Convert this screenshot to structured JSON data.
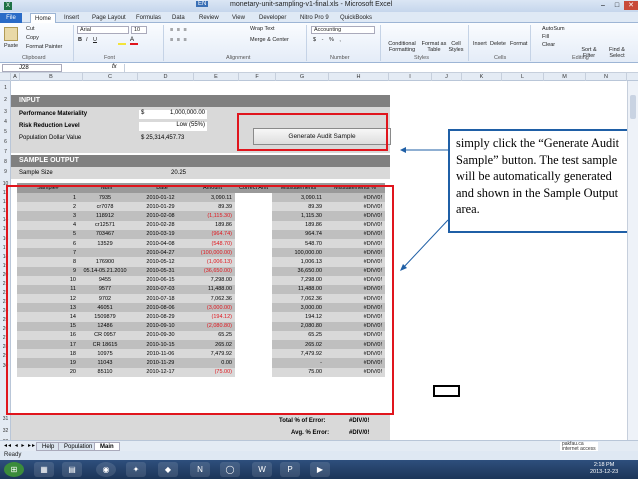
{
  "window": {
    "title": "monetary-unit-sampling-v1-final.xls - Microsoft Excel",
    "lang": "EN"
  },
  "ribbon_tabs": [
    "File",
    "Home",
    "Insert",
    "Page Layout",
    "Formulas",
    "Data",
    "Review",
    "View",
    "Developer",
    "Nitro Pro 9",
    "QuickBooks"
  ],
  "ribbon": {
    "clipboard": {
      "paste": "Paste",
      "cut": "Cut",
      "copy": "Copy",
      "format_painter": "Format Painter",
      "group": "Clipboard"
    },
    "font": {
      "name": "Arial",
      "size": "10",
      "group": "Font"
    },
    "alignment": {
      "wrap": "Wrap Text",
      "merge": "Merge & Center",
      "group": "Alignment"
    },
    "number": {
      "format": "Accounting",
      "symbols": "$ - % ,",
      "group": "Number"
    },
    "styles": {
      "cond": "Conditional Formatting",
      "fmt_table": "Format as Table",
      "cell_styles": "Cell Styles",
      "group": "Styles"
    },
    "cells": {
      "insert": "Insert",
      "delete": "Delete",
      "format": "Format",
      "group": "Cells"
    },
    "editing": {
      "autosum": "AutoSum",
      "fill": "Fill",
      "clear": "Clear",
      "sort": "Sort & Filter",
      "find": "Find & Select",
      "group": "Editing"
    }
  },
  "formula_bar": {
    "name_box": "J28",
    "fx": "fx",
    "value": ""
  },
  "columns": [
    "A",
    "B",
    "C",
    "D",
    "E",
    "F",
    "G",
    "H",
    "I",
    "J",
    "K",
    "L",
    "M",
    "N"
  ],
  "rows": [
    "1",
    "2",
    "3",
    "4",
    "5",
    "6",
    "7",
    "8",
    "9",
    "10",
    "11",
    "12",
    "13",
    "14",
    "15",
    "16",
    "17",
    "18",
    "19",
    "20",
    "21",
    "22",
    "23",
    "24",
    "25",
    "26",
    "27",
    "28",
    "29",
    "30",
    "31",
    "32",
    "33"
  ],
  "input": {
    "header": "INPUT",
    "materiality_label": "Performance Materiality",
    "materiality_sym": "$",
    "materiality_value": "1,000,000.00",
    "risk_label": "Risk Reduction Level",
    "risk_value": "Low (55%)",
    "population_label": "Population Dollar Value",
    "population_value": "$ 25,314,457.73",
    "button": "Generate Audit Sample"
  },
  "output": {
    "header": "SAMPLE OUTPUT",
    "size_label": "Sample Size",
    "size_value": "20.25",
    "columns": [
      "Sample#",
      "Num",
      "Date",
      "Amount",
      "Correct Amt",
      "Misstatements",
      "Misstatements %"
    ],
    "rows": [
      [
        "1",
        "7935",
        "2010-01-12",
        "3,090.11",
        "",
        "3,090.11",
        "#DIV/0!"
      ],
      [
        "2",
        "cr7078",
        "2010-01-29",
        "89.39",
        "",
        "89.39",
        "#DIV/0!"
      ],
      [
        "3",
        "118912",
        "2010-02-08",
        "(1,115.30)",
        "",
        "1,115.30",
        "#DIV/0!"
      ],
      [
        "4",
        "cr12571",
        "2010-02-28",
        "189.86",
        "",
        "189.86",
        "#DIV/0!"
      ],
      [
        "5",
        "703467",
        "2010-03-19",
        "(964.74)",
        "",
        "964.74",
        "#DIV/0!"
      ],
      [
        "6",
        "13529",
        "2010-04-08",
        "(548.70)",
        "",
        "548.70",
        "#DIV/0!"
      ],
      [
        "7",
        "",
        "2010-04-27",
        "(100,000.00)",
        "",
        "100,000.00",
        "#DIV/0!"
      ],
      [
        "8",
        "176900",
        "2010-05-12",
        "(1,006.13)",
        "",
        "1,006.13",
        "#DIV/0!"
      ],
      [
        "9",
        "05.14-05.21.2010",
        "2010-05-31",
        "(36,650.00)",
        "",
        "36,650.00",
        "#DIV/0!"
      ],
      [
        "10",
        "9455",
        "2010-06-15",
        "7,298.00",
        "",
        "7,298.00",
        "#DIV/0!"
      ],
      [
        "11",
        "9577",
        "2010-07-03",
        "11,488.00",
        "",
        "11,488.00",
        "#DIV/0!"
      ],
      [
        "12",
        "9702",
        "2010-07-18",
        "7,062.36",
        "",
        "7,062.36",
        "#DIV/0!"
      ],
      [
        "13",
        "46051",
        "2010-08-06",
        "(3,000.00)",
        "",
        "3,000.00",
        "#DIV/0!"
      ],
      [
        "14",
        "1509879",
        "2010-08-29",
        "(194.12)",
        "",
        "194.12",
        "#DIV/0!"
      ],
      [
        "15",
        "12486",
        "2010-09-10",
        "(2,080.80)",
        "",
        "2,080.80",
        "#DIV/0!"
      ],
      [
        "16",
        "CR 0957",
        "2010-09-30",
        "65.25",
        "",
        "65.25",
        "#DIV/0!"
      ],
      [
        "17",
        "CR 18615",
        "2010-10-15",
        "265.02",
        "",
        "265.02",
        "#DIV/0!"
      ],
      [
        "18",
        "10975",
        "2010-11-06",
        "7,479.92",
        "",
        "7,479.92",
        "#DIV/0!"
      ],
      [
        "19",
        "11043",
        "2010-11-29",
        "0.00",
        "",
        "-",
        "#DIV/0!"
      ],
      [
        "20",
        "85110",
        "2010-12-17",
        "(75.00)",
        "",
        "75.00",
        "#DIV/0!"
      ]
    ],
    "total_label": "Total % of Error:",
    "total_value": "#DIV/0!",
    "avg_label": "Avg. % Error:",
    "avg_value": "#DIV/0!"
  },
  "callout": "simply click the “Generate Audit Sample” button. The test sample will be automatically generated and shown in the Sample Output area.",
  "sheet_tabs": [
    "Help",
    "Population",
    "Main"
  ],
  "status": "Ready",
  "clock": {
    "time": "2:18 PM",
    "date": "2013-12-23"
  },
  "watermark": {
    "site": "pakfau.ca",
    "note": "internet access"
  },
  "colors": {
    "accent_red": "#e0151d",
    "callout_blue": "#1f5fa6",
    "band_gray": "#808080"
  }
}
